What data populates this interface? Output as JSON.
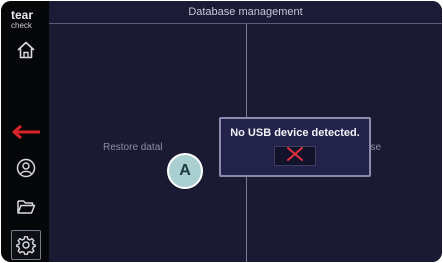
{
  "brand": {
    "line1": "tear",
    "line2": "check"
  },
  "sidebar": {
    "items": [
      {
        "icon": "home-icon"
      },
      {
        "icon": "back-arrow-icon",
        "color": "#d8232a"
      },
      {
        "icon": "user-icon"
      },
      {
        "icon": "folder-icon"
      },
      {
        "icon": "settings-gear-icon"
      }
    ]
  },
  "header": {
    "title": "Database management"
  },
  "panels": {
    "left_label": "Restore datal",
    "right_label": "kup database"
  },
  "dialog": {
    "message": "No USB device detected.",
    "close_icon": "close-x-icon",
    "close_color": "#e2313a"
  },
  "callout": {
    "label": "A"
  },
  "colors": {
    "background": "#1b1a33",
    "sidebar": "#060709",
    "dialog_bg": "#23224a",
    "dialog_border": "#8b8bb0",
    "callout": "#a9cfd0"
  }
}
